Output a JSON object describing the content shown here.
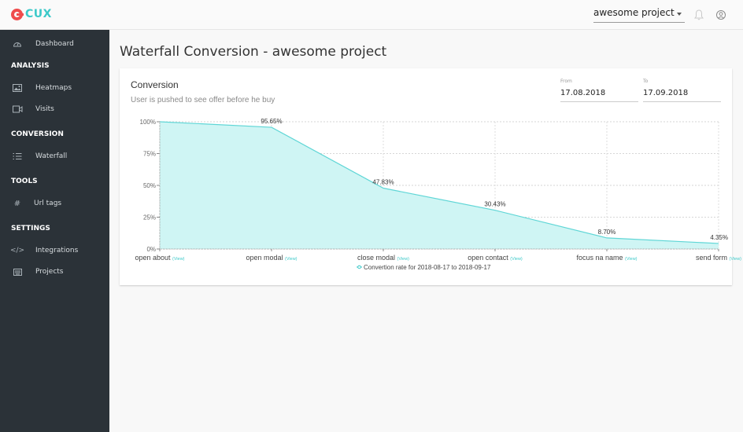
{
  "app": {
    "logo_text": "CUX"
  },
  "header": {
    "project_select": "awesome project",
    "icons": [
      "bell-icon",
      "account-icon"
    ]
  },
  "sidebar": {
    "items": [
      {
        "type": "item",
        "label": "Dashboard",
        "icon": "dashboard-gauge-icon"
      },
      {
        "type": "section",
        "label": "ANALYSIS"
      },
      {
        "type": "item",
        "label": "Heatmaps",
        "icon": "image-icon"
      },
      {
        "type": "item",
        "label": "Visits",
        "icon": "video-icon"
      },
      {
        "type": "section",
        "label": "CONVERSION"
      },
      {
        "type": "item",
        "label": "Waterfall",
        "icon": "list-icon"
      },
      {
        "type": "section",
        "label": "TOOLS"
      },
      {
        "type": "item",
        "label": "Url tags",
        "icon": "hash-icon"
      },
      {
        "type": "section",
        "label": "SETTINGS"
      },
      {
        "type": "item",
        "label": "Integrations",
        "icon": "code-icon"
      },
      {
        "type": "item",
        "label": "Projects",
        "icon": "keyboard-icon"
      }
    ]
  },
  "page": {
    "title": "Waterfall Conversion - awesome project"
  },
  "card": {
    "title": "Conversion",
    "subtitle": "User is pushed to see offer before he buy",
    "from_label": "From",
    "from_value": "17.08.2018",
    "to_label": "To",
    "to_value": "17.09.2018",
    "view_link_label": "(View)"
  },
  "colors": {
    "accent": "#3cc9c9",
    "area_fill": "#cff5f4",
    "line": "#5fd6d6",
    "sidebar_bg": "#2b3238",
    "logo_red": "#ef4c4c"
  },
  "chart_data": {
    "type": "area",
    "categories": [
      "open about",
      "open modal",
      "close modal",
      "open contact",
      "focus na name",
      "send form"
    ],
    "series": [
      {
        "name": "Convertion rate for 2018-08-17 to 2018-09-17",
        "values": [
          100,
          95.65,
          47.83,
          30.43,
          8.7,
          4.35
        ]
      }
    ],
    "data_labels": [
      "",
      "95.65%",
      "47.83%",
      "30.43%",
      "8.70%",
      "4.35%"
    ],
    "yticks": [
      "0%",
      "25%",
      "50%",
      "75%",
      "100%"
    ],
    "ylim": [
      0,
      100
    ],
    "grid": true,
    "legend": "bottom-center",
    "title": "",
    "xlabel": "",
    "ylabel": ""
  }
}
